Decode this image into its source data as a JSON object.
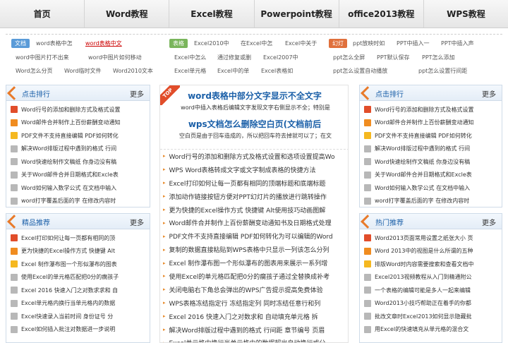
{
  "nav": [
    "首页",
    "Word教程",
    "Excel教程",
    "Powerpoint教程",
    "office2013教程",
    "WPS教程"
  ],
  "tags": {
    "row1": {
      "word_label": "文档",
      "word": [
        "word表格中怎",
        "word表格中文"
      ],
      "excel_label": "表格",
      "excel": [
        "Excel2010中",
        "在Excel中怎",
        "Excel中关于"
      ],
      "ppt_label": "幻灯",
      "ppt": [
        "ppt放映时如",
        "PPT中插入一",
        "PPT中插入声"
      ]
    },
    "row2": {
      "word": [
        "word中图片打不出来",
        "word中图片如何移动"
      ],
      "excel": [
        "Excel中怎么",
        "通过修复或删",
        "Excel2007中"
      ],
      "ppt": [
        "ppt怎么全屏",
        "PPT默认保存",
        "PPT怎么添加"
      ]
    },
    "row3": {
      "word": [
        "Word怎么分页",
        "Word临时文件",
        "Word2010文本"
      ],
      "excel": [
        "Excel单元格",
        "Excel中的单",
        "Excel表格如"
      ],
      "ppt": [
        "ppt怎么设置自动播放",
        "ppt怎么设置行间距"
      ]
    }
  },
  "left_rank": {
    "title": "点击排行",
    "more": "更多",
    "items": [
      "Word行号的添加和删除方式及格式设置",
      "Word邮件合并制作上百份薪酬变动通知",
      "PDF文件不支持直接编辑 PDF如何转化",
      "解决Word排版过程中遇到的格式 行间",
      "Word快速绘制作文稿纸 你身边没有稿",
      "关于Word邮件合并日期格式和Excle表",
      "Word如何输入数学公式 在文档中输入",
      "word打字覆盖后面的字 在修改内容时"
    ]
  },
  "left_rec": {
    "title": "精品推荐",
    "more": "更多",
    "items": [
      "Excel打印如何让每一页都有相同的顶",
      "更为快捷的Excel操作方式 快捷键 Alt",
      "Excel 制作瀑布图一个形似瀑布的图表",
      "使用Excel的单元格匹配把0分的瘸孩子",
      "Excel 2016 快速入门之对数求求和 自",
      "Excel单元格内换行当单元格内的数据",
      "Excel快速录入当前时间 身份证号 分",
      "Excel如何插入批注对数据进一步说明"
    ]
  },
  "right_rank": {
    "title": "点击排行",
    "more": "更多",
    "items": [
      "Word行号的添加和删除方式及格式设置",
      "Word邮件合并制作上百份薪酬变动通知",
      "PDF文件不支持直接编辑 PDF如何转化",
      "解决Word排版过程中遇到的格式 行间",
      "Word快速绘制作文稿纸 你身边没有稿",
      "关于Word邮件合并日期格式和Excle表",
      "Word如何输入数学公式 在文档中输入",
      "word打字覆盖后面的字 在修改内容时"
    ]
  },
  "right_rec": {
    "title": "热门推荐",
    "more": "更多",
    "items": [
      "Word2013页面常用设置之纸张大小 页",
      "Word 2013中的视图是什么所谓的五种",
      "排版Word时内容需要搜索和查看文档中",
      "Excel2013视频教程从入门到精通附公",
      "一个表格的编辑可能是多人一起来编辑",
      "Word2013小技巧帮助正在着手的你都",
      "批改文章时Excel2013如何显示隐藏批",
      "用Excel的快速填充从单元格的混合文"
    ]
  },
  "middle": {
    "badge": "TOP",
    "headline1": "word表格中部分文字显示不全文字",
    "sub1": "word中插入表格后编辑文字发现文字右侧显示不全；特别是",
    "headline2": "wps文档怎么删除空白页(文档前后",
    "sub2": "空白页是由于回车造成的，所以把回车符去掉就可以了；在文",
    "items": [
      "Word行号的添加和删除方式及格式设置和选项设置提高Wo",
      "WPS Word表格转成文字或文字制成表格的快捷方法",
      "Excel打印如何让每一页都有相同的顶端标题和底端标题",
      "添加动作链接按钮方便对PPT幻灯片的播放进行跳转操作",
      "更为快捷的Excel操作方式 快捷键 Alt使用技巧动画图解",
      "Word邮件合并制作上百份薪酬变动通知书及日期格式处理",
      "PDF文件不支持直接编辑 PDF如何转化为可以编辑的Word",
      "复制的数据直接粘贴到WPS表格中只显示一列该怎么分列",
      "Excel 制作瀑布图一个形似瀑布的图表用来展示一系列增",
      "使用Excel的单元格匹配把0分的瘸孩子通过全替换成补考",
      "关闭电脑右下角总会弹出的WPS广告提示提高免费体验",
      "WPS表格冻结指定行 冻结指定列 同时冻结任意行和列",
      "Excel 2016 快速入门之对数求和 自动填充单元格 拆",
      "解决Word排版过程中遇到的格式 行间距 章节编号 页眉",
      "Excel单元格内换行当单元格内的数据超出自动换行或分"
    ]
  }
}
